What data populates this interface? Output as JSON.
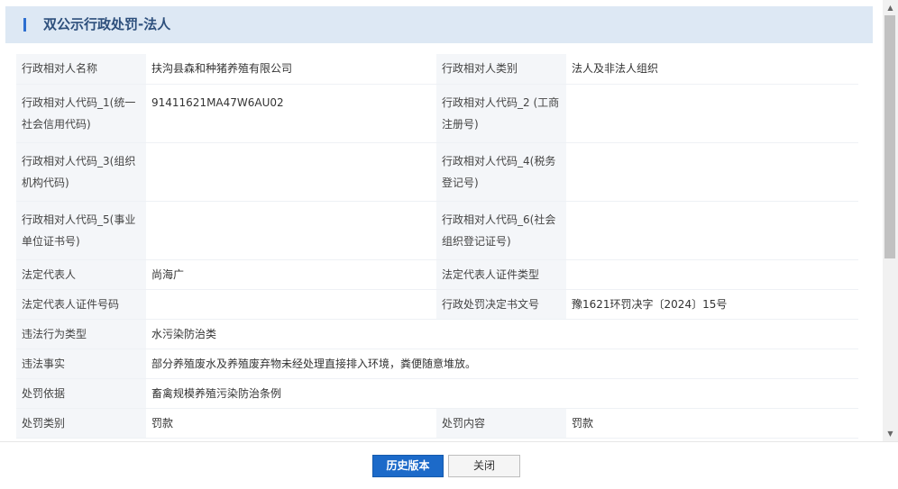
{
  "header": {
    "title": "双公示行政处罚-法人"
  },
  "rows": [
    {
      "l1": "行政相对人名称",
      "v1": "扶沟县森和种猪养殖有限公司",
      "l2": "行政相对人类别",
      "v2": "法人及非法人组织"
    },
    {
      "l1": "行政相对人代码_1(统一社会信用代码)",
      "v1": "91411621MA47W6AU02",
      "l2": "行政相对人代码_2 (工商注册号)",
      "v2": ""
    },
    {
      "l1": "行政相对人代码_3(组织机构代码)",
      "v1": "",
      "l2": "行政相对人代码_4(税务登记号)",
      "v2": ""
    },
    {
      "l1": "行政相对人代码_5(事业单位证书号)",
      "v1": "",
      "l2": "行政相对人代码_6(社会组织登记证号)",
      "v2": ""
    },
    {
      "l1": "法定代表人",
      "v1": "尚海广",
      "l2": "法定代表人证件类型",
      "v2": ""
    },
    {
      "l1": "法定代表人证件号码",
      "v1": "",
      "l2": "行政处罚决定书文号",
      "v2": "豫1621环罚决字〔2024〕15号"
    }
  ],
  "wide_rows": [
    {
      "label": "违法行为类型",
      "value": "水污染防治类"
    },
    {
      "label": "违法事实",
      "value": "部分养殖废水及养殖废弃物未经处理直接排入环境，粪便随意堆放。"
    },
    {
      "label": "处罚依据",
      "value": "畜禽规模养殖污染防治条例"
    }
  ],
  "last_row": {
    "l1": "处罚类别",
    "v1": "罚款",
    "l2": "处罚内容",
    "v2": "罚款"
  },
  "footer": {
    "history_label": "历史版本",
    "close_label": "关闭"
  },
  "colors": {
    "accent": "#1c6ac9",
    "header_bg": "#dde8f4",
    "label_bg": "#f4f6f9"
  }
}
